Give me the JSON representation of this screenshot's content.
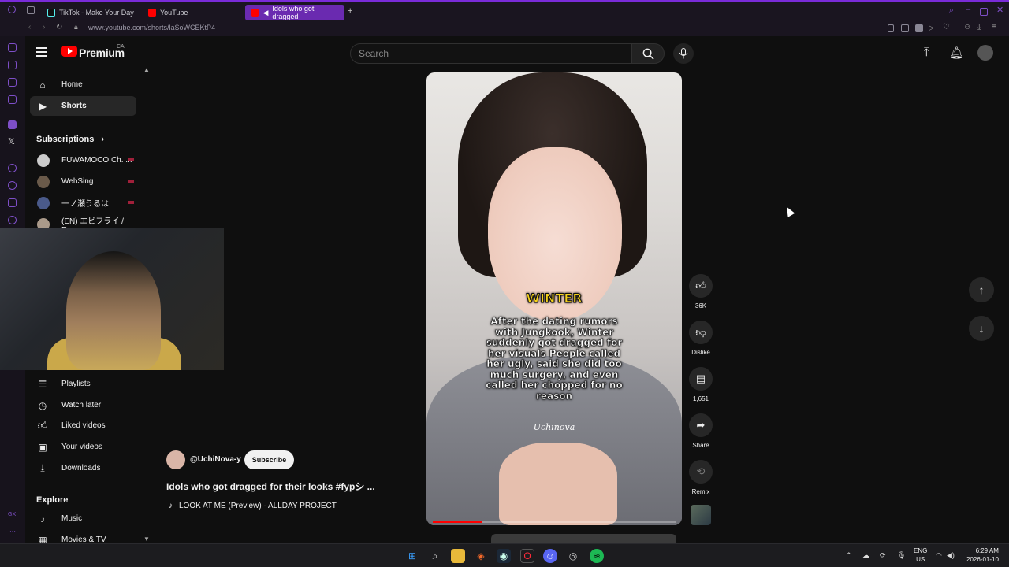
{
  "browser": {
    "tabs": [
      {
        "label": "TikTok - Make Your Day",
        "active": false
      },
      {
        "label": "YouTube",
        "active": false
      },
      {
        "label": "Idols who got dragged",
        "active": true
      }
    ],
    "url": "www.youtube.com/shorts/laSoWCEKtP4"
  },
  "header": {
    "brand": "Premium",
    "region": "CA",
    "search_placeholder": "Search"
  },
  "sidebar": {
    "main": [
      {
        "label": "Home",
        "icon": "home-icon"
      },
      {
        "label": "Shorts",
        "icon": "shorts-icon",
        "selected": true
      }
    ],
    "subscriptions_title": "Subscriptions",
    "subscriptions": [
      {
        "label": "FUWAMOCO Ch. ..."
      },
      {
        "label": "WehSing"
      },
      {
        "label": "一ノ瀬うるは"
      },
      {
        "label": "(EN) エビフライ / E..."
      }
    ],
    "you": [
      {
        "label": "Playlists",
        "icon": "playlist-icon"
      },
      {
        "label": "Watch later",
        "icon": "clock-icon"
      },
      {
        "label": "Liked videos",
        "icon": "thumbs-up-icon"
      },
      {
        "label": "Your videos",
        "icon": "video-icon"
      },
      {
        "label": "Downloads",
        "icon": "download-icon"
      }
    ],
    "explore_title": "Explore",
    "explore": [
      {
        "label": "Music",
        "icon": "music-icon"
      },
      {
        "label": "Movies & TV",
        "icon": "film-icon"
      }
    ]
  },
  "short": {
    "overlay_title": "WINTER",
    "overlay_body": "After the dating rumors with Jungkook, Winter suddenly got dragged for her visuals People called her ugly, said she did too much surgery, and even called her chopped for no reason",
    "watermark": "Uchinova",
    "progress": 0.2,
    "channel": "@UchiNova-y",
    "subscribe_label": "Subscribe",
    "title": "Idols who got dragged for their looks #fypシ ...",
    "music": "LOOK AT ME  (Preview) · ALLDAY PROJECT"
  },
  "actions": {
    "like_count": "36K",
    "dislike_label": "Dislike",
    "comment_count": "1,651",
    "share_label": "Share",
    "remix_label": "Remix"
  },
  "taskbar": {
    "lang_top": "ENG",
    "lang_bottom": "US",
    "time": "6:29 AM",
    "date": "2026-01-10"
  },
  "colors": {
    "accent": "#ff0000",
    "opera_purple": "#6a2ab0",
    "background": "#0f0f0f"
  }
}
